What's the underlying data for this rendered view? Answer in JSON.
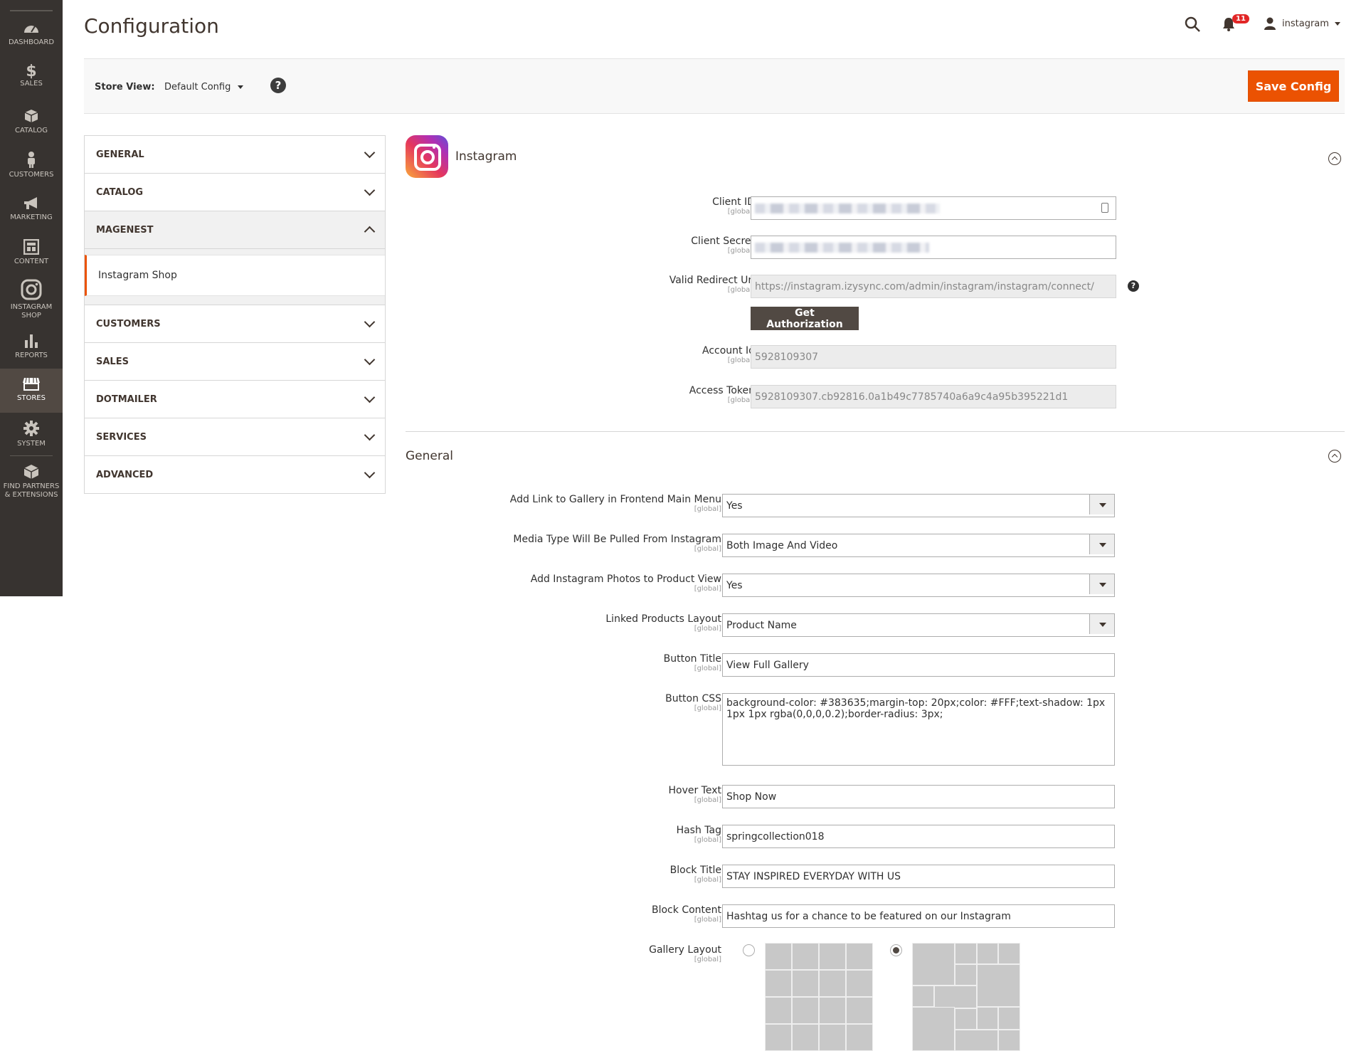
{
  "nav": {
    "items": [
      {
        "label": "Dashboard",
        "icon": "dashboard-icon"
      },
      {
        "label": "$",
        "icon": "dollar-icon"
      },
      {
        "label": "Sales",
        "icon": "dollar-icon"
      },
      {
        "label": "Catalog",
        "icon": "box-icon"
      },
      {
        "label": "Customers",
        "icon": "person-icon"
      },
      {
        "label": "Marketing",
        "icon": "megaphone-icon"
      },
      {
        "label": "Content",
        "icon": "layout-icon"
      },
      {
        "label": "Instagram Shop",
        "icon": "instagram-icon"
      },
      {
        "label": "Reports",
        "icon": "bar-chart-icon"
      },
      {
        "label": "Stores",
        "icon": "store-icon"
      },
      {
        "label": "System",
        "icon": "gear-icon"
      },
      {
        "label": "Find Partners & Extensions",
        "icon": "cube-icon"
      }
    ]
  },
  "header": {
    "title": "Configuration",
    "notifications": "11",
    "user": "instagram"
  },
  "store_bar": {
    "label": "Store View:",
    "value": "Default Config",
    "help": "?",
    "save": "Save Config"
  },
  "tabs": {
    "general": "GENERAL",
    "catalog": "CATALOG",
    "magenest": "MAGENEST",
    "instagram_shop": "Instagram Shop",
    "customers": "CUSTOMERS",
    "sales": "SALES",
    "dotmailer": "DOTMAILER",
    "services": "SERVICES",
    "advanced": "ADVANCED"
  },
  "instagram": {
    "title": "Instagram",
    "scope": "[global]",
    "client_id_label": "Client ID",
    "client_secret_label": "Client Secret",
    "redirect_label": "Valid Redirect Uri",
    "redirect_value": "https://instagram.izysync.com/admin/instagram/instagram/connect/",
    "auth_button": "Get Authorization",
    "account_id_label": "Account Id",
    "account_id_value": "5928109307",
    "token_label": "Access Token",
    "token_value": "5928109307.cb92816.0a1b49c7785740a6a9c4a95b395221d1"
  },
  "general": {
    "title": "General",
    "scope": "[global]",
    "link_label": "Add Link to Gallery in Frontend Main Menu",
    "link_value": "Yes",
    "media_label": "Media Type Will Be Pulled From Instagram",
    "media_value": "Both Image And Video",
    "photos_label": "Add Instagram Photos to Product View",
    "photos_value": "Yes",
    "linked_label": "Linked Products Layout",
    "linked_value": "Product Name",
    "btn_title_label": "Button Title",
    "btn_title_value": "View Full Gallery",
    "btn_css_label": "Button CSS",
    "btn_css_value": "background-color: #383635;margin-top: 20px;color: #FFF;text-shadow: 1px 1px 1px rgba(0,0,0,0.2);border-radius: 3px;",
    "hover_label": "Hover Text",
    "hover_value": "Shop Now",
    "hash_label": "Hash Tag",
    "hash_value": "springcollection018",
    "block_title_label": "Block Title",
    "block_title_value": "STAY INSPIRED EVERYDAY WITH US",
    "block_content_label": "Block Content",
    "block_content_value": "Hashtag us for a chance to be featured on our Instagram",
    "gallery_label": "Gallery Layout"
  },
  "colors": {
    "accent": "#eb5202",
    "nav_bg": "#373330",
    "nav_active": "#514943"
  }
}
